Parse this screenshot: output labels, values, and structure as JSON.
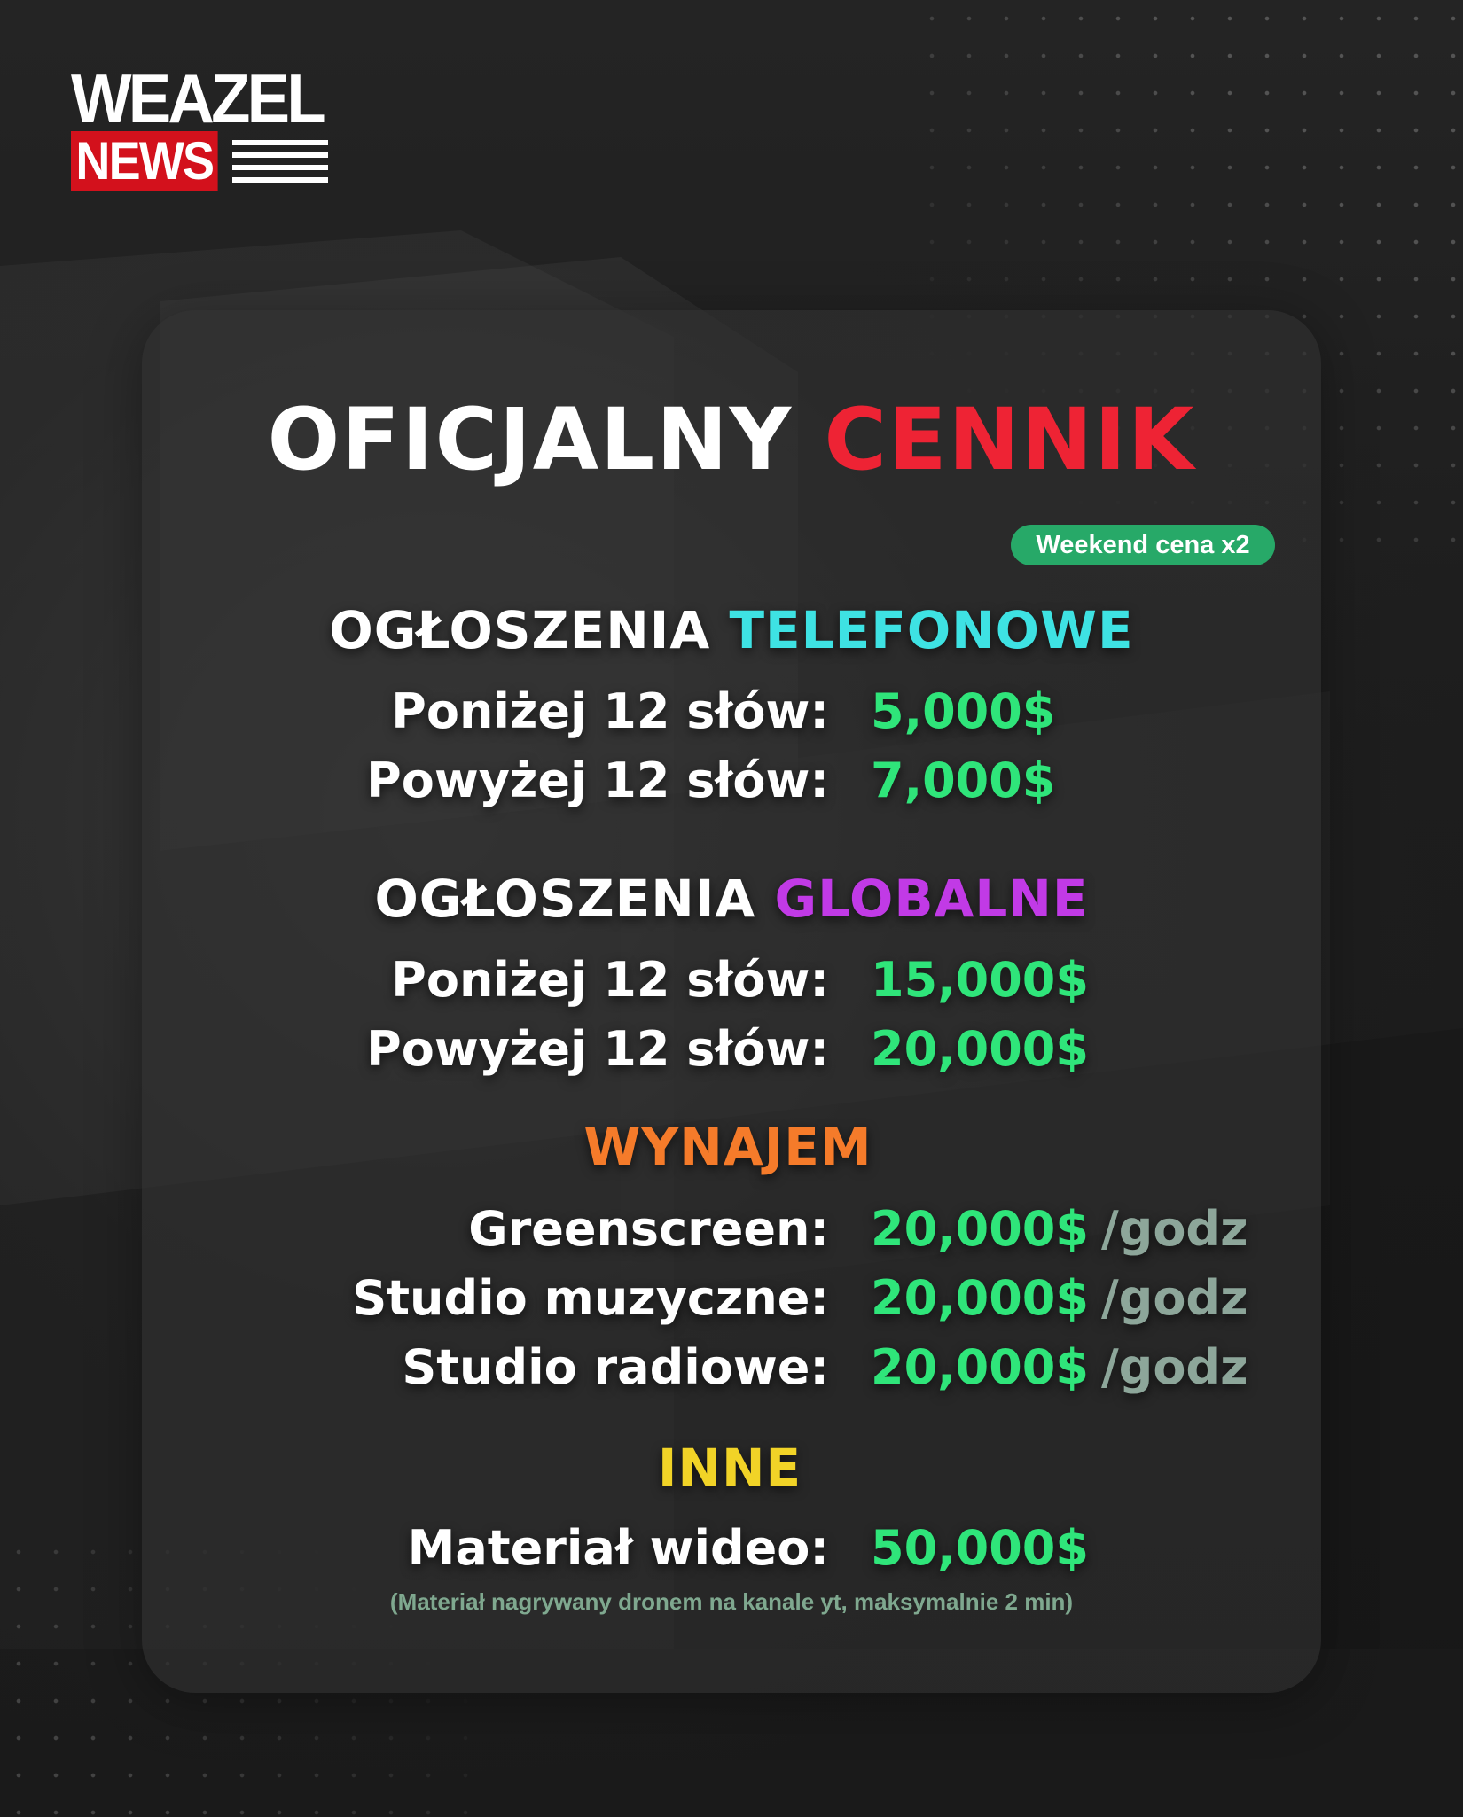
{
  "logo": {
    "top_text": "WEAZEL",
    "bottom_text": "NEWS",
    "accent_color": "#d3111c"
  },
  "title": {
    "part1": "OFICJALNY",
    "part2": "CENNIK"
  },
  "badge": "Weekend cena x2",
  "sections": {
    "phone": {
      "heading_part1": "OGŁOSZENIA",
      "heading_part2": "TELEFONOWE",
      "rows": [
        {
          "label": "Poniżej 12 słów:",
          "price": "5,000$"
        },
        {
          "label": "Powyżej 12 słów:",
          "price": "7,000$"
        }
      ]
    },
    "global": {
      "heading_part1": "OGŁOSZENIA",
      "heading_part2": "GLOBALNE",
      "rows": [
        {
          "label": "Poniżej 12 słów:",
          "price": "15,000$"
        },
        {
          "label": "Powyżej 12 słów:",
          "price": "20,000$"
        }
      ]
    },
    "rental": {
      "heading": "WYNAJEM",
      "rows": [
        {
          "label": "Greenscreen:",
          "price": "20,000$",
          "unit": "/godz"
        },
        {
          "label": "Studio muzyczne:",
          "price": "20,000$",
          "unit": "/godz"
        },
        {
          "label": "Studio radiowe:",
          "price": "20,000$",
          "unit": "/godz"
        }
      ]
    },
    "other": {
      "heading": "INNE",
      "rows": [
        {
          "label": "Materiał wideo:",
          "price": "50,000$"
        }
      ],
      "note": "(Materiał nagrywany dronem na kanale yt, maksymalnie 2 min)"
    }
  },
  "colors": {
    "title_accent": "#ee2334",
    "phone_accent": "#3ee2e3",
    "global_accent": "#c13ae6",
    "rental_accent": "#f57b2a",
    "other_accent": "#f1d327",
    "price": "#2fe57a",
    "unit": "#8da69a",
    "badge": "#27a968"
  }
}
